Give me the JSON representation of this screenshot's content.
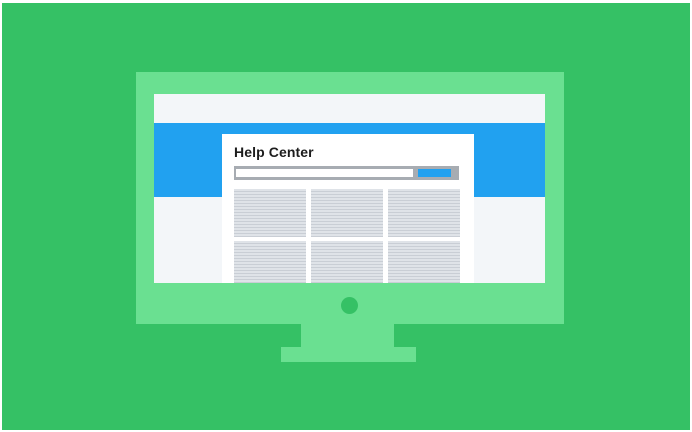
{
  "illustration": {
    "card_title": "Help Center",
    "tile_count": 6
  },
  "colors": {
    "background": "#35c165",
    "monitor": "#6ae091",
    "screen": "#f3f6f9",
    "accent_blue": "#21a1f0",
    "search_bar": "#a7acb2",
    "tile": "#dfe3e8"
  }
}
